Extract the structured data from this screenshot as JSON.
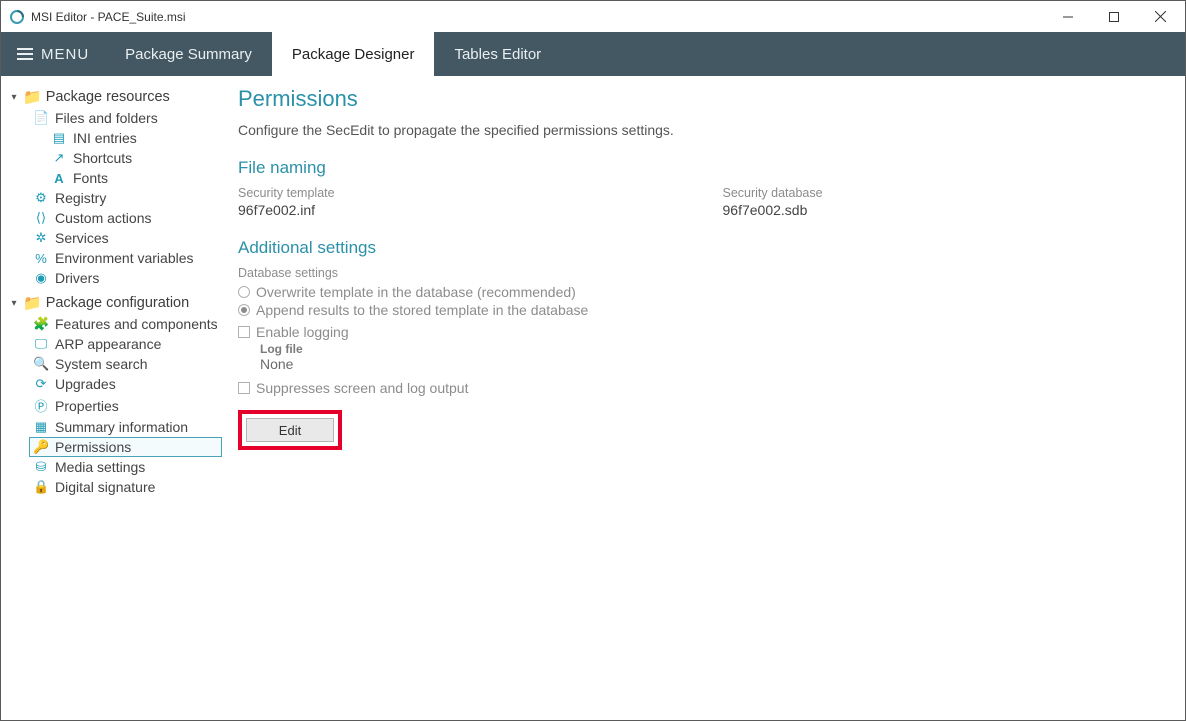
{
  "window": {
    "title": "MSI Editor - PACE_Suite.msi"
  },
  "menu": {
    "label": "MENU"
  },
  "tabs": {
    "summary": "Package Summary",
    "designer": "Package Designer",
    "tables": "Tables Editor"
  },
  "sidebar": {
    "resources": {
      "label": "Package resources",
      "items": {
        "files": "Files and folders",
        "ini": "INI entries",
        "shortcuts": "Shortcuts",
        "fonts": "Fonts",
        "registry": "Registry",
        "custom": "Custom actions",
        "services": "Services",
        "env": "Environment variables",
        "drivers": "Drivers"
      }
    },
    "config": {
      "label": "Package configuration",
      "items": {
        "features": "Features and components",
        "arp": "ARP appearance",
        "search": "System search",
        "upgrades": "Upgrades",
        "properties": "Properties",
        "summary": "Summary information",
        "permissions": "Permissions",
        "media": "Media settings",
        "digital": "Digital signature"
      }
    }
  },
  "content": {
    "title": "Permissions",
    "description": "Configure the SecEdit to propagate the specified permissions settings.",
    "file_naming": {
      "heading": "File naming",
      "template_label": "Security template",
      "template_value": "96f7e002.inf",
      "database_label": "Security database",
      "database_value": "96f7e002.sdb"
    },
    "additional": {
      "heading": "Additional settings",
      "db_settings_label": "Database settings",
      "opt_overwrite": "Overwrite template in the database (recommended)",
      "opt_append": "Append results to the stored template in the database",
      "enable_logging": "Enable logging",
      "log_file_label": "Log file",
      "log_file_value": "None",
      "suppress": "Suppresses screen and log output"
    },
    "edit_button": "Edit"
  }
}
